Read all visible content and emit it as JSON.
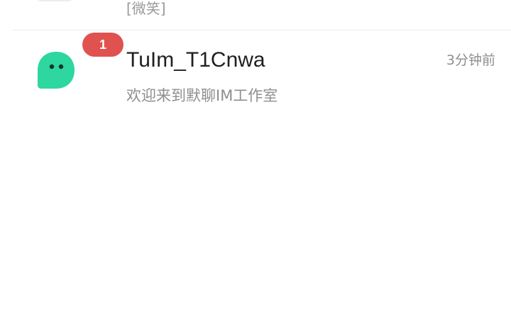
{
  "conversations": [
    {
      "preview": "[微笑]"
    },
    {
      "name": "TuIm_T1Cnwa",
      "time": "3分钟前",
      "preview": "欢迎来到默聊IM工作室",
      "unread_count": "1",
      "avatar_icon": "chat-bubble-face-icon",
      "avatar_color": "#2ed6a0"
    }
  ]
}
